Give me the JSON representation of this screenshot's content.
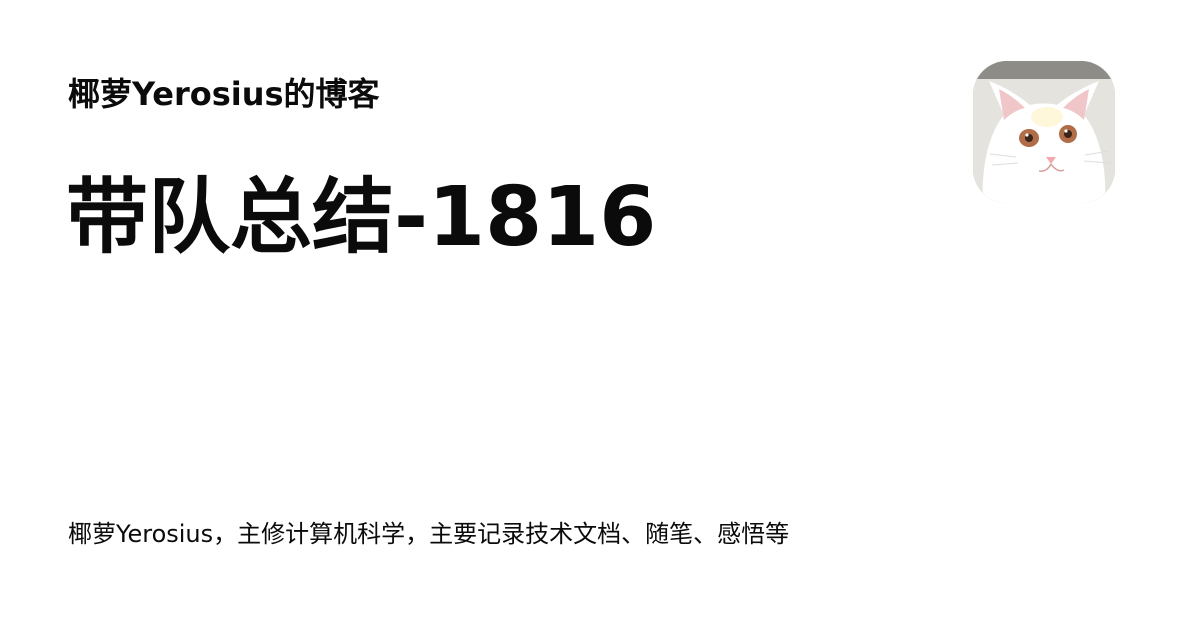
{
  "site": {
    "name": "椰萝Yerosius的博客",
    "description": "椰萝Yerosius，主修计算机科学，主要记录技术文档、随笔、感悟等"
  },
  "post": {
    "title": "带队总结-1816"
  },
  "avatar": {
    "icon": "cat-avatar-icon"
  },
  "colors": {
    "background": "#ffffff",
    "text": "#0b0b0b"
  }
}
